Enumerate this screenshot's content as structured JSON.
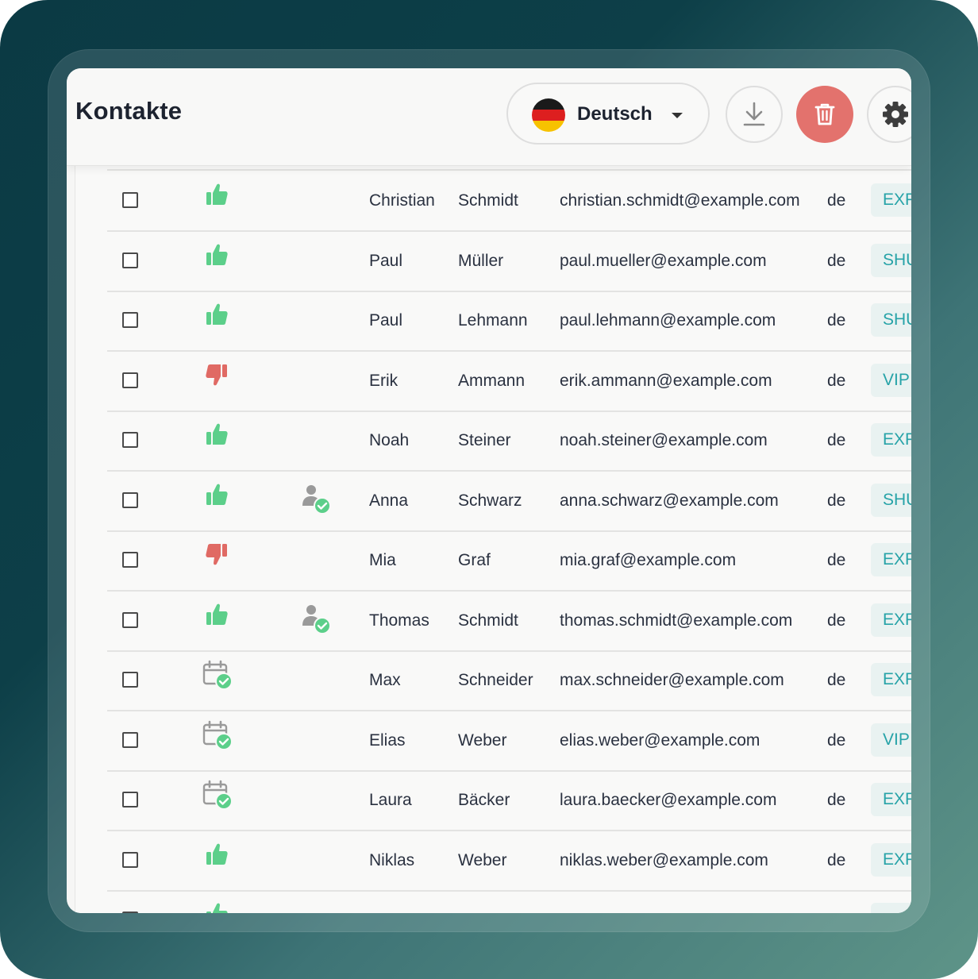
{
  "header": {
    "title": "Kontakte",
    "language": {
      "label": "Deutsch",
      "flag": [
        "#1a1a1a",
        "#dd1f1f",
        "#f7c200"
      ]
    },
    "actions": {
      "download": "download-icon",
      "delete": "trash-icon",
      "settings": "gear-icon"
    }
  },
  "colors": {
    "thumb_up": "#5ccf8a",
    "thumb_down": "#e06a64",
    "tag_text": "#27a3a8",
    "tag_bg": "#e9f2f1",
    "delete_button": "#e3726d"
  },
  "contacts": [
    {
      "status": "thumbs-up",
      "verified": false,
      "first": "Christian",
      "last": "Schmidt",
      "email": "christian.schmidt@example.com",
      "lang": "de",
      "tag": "EXPE"
    },
    {
      "status": "thumbs-up",
      "verified": false,
      "first": "Paul",
      "last": "Müller",
      "email": "paul.mueller@example.com",
      "lang": "de",
      "tag": "SHUT"
    },
    {
      "status": "thumbs-up",
      "verified": false,
      "first": "Paul",
      "last": "Lehmann",
      "email": "paul.lehmann@example.com",
      "lang": "de",
      "tag": "SHUT"
    },
    {
      "status": "thumbs-down",
      "verified": false,
      "first": "Erik",
      "last": "Ammann",
      "email": "erik.ammann@example.com",
      "lang": "de",
      "tag": "VIP"
    },
    {
      "status": "thumbs-up",
      "verified": false,
      "first": "Noah",
      "last": "Steiner",
      "email": "noah.steiner@example.com",
      "lang": "de",
      "tag": "EXPE"
    },
    {
      "status": "thumbs-up",
      "verified": true,
      "first": "Anna",
      "last": "Schwarz",
      "email": "anna.schwarz@example.com",
      "lang": "de",
      "tag": "SHUT"
    },
    {
      "status": "thumbs-down",
      "verified": false,
      "first": "Mia",
      "last": "Graf",
      "email": "mia.graf@example.com",
      "lang": "de",
      "tag": "EXPE"
    },
    {
      "status": "thumbs-up",
      "verified": true,
      "first": "Thomas",
      "last": "Schmidt",
      "email": "thomas.schmidt@example.com",
      "lang": "de",
      "tag": "EXPE"
    },
    {
      "status": "calendar-check",
      "verified": false,
      "first": "Max",
      "last": "Schneider",
      "email": "max.schneider@example.com",
      "lang": "de",
      "tag": "EXPE"
    },
    {
      "status": "calendar-check",
      "verified": false,
      "first": "Elias",
      "last": "Weber",
      "email": "elias.weber@example.com",
      "lang": "de",
      "tag": "VIP"
    },
    {
      "status": "calendar-check",
      "verified": false,
      "first": "Laura",
      "last": "Bäcker",
      "email": "laura.baecker@example.com",
      "lang": "de",
      "tag": "EXPE"
    },
    {
      "status": "thumbs-up",
      "verified": false,
      "first": "Niklas",
      "last": "Weber",
      "email": "niklas.weber@example.com",
      "lang": "de",
      "tag": "EXPE"
    },
    {
      "status": "thumbs-up",
      "verified": false,
      "first": "",
      "last": "",
      "email": "",
      "lang": "",
      "tag": ""
    }
  ]
}
